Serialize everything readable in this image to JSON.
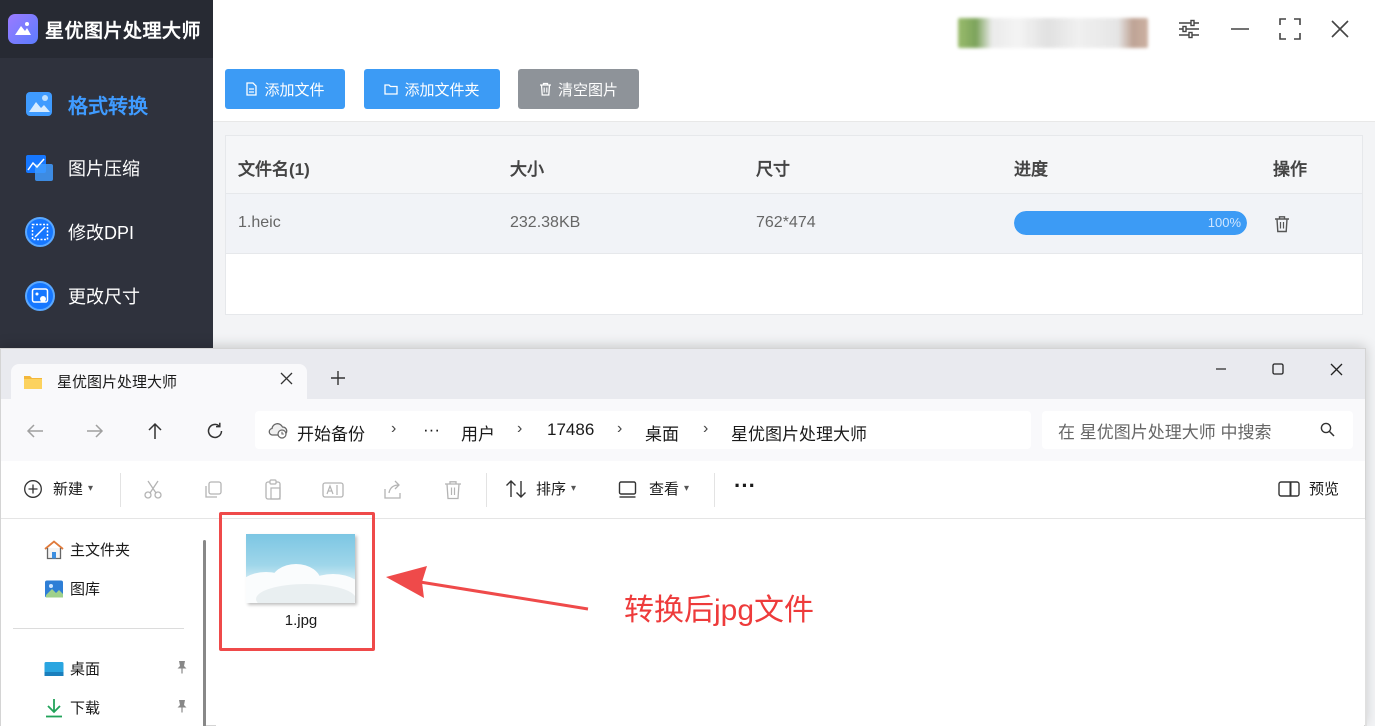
{
  "app": {
    "title": "星优图片处理大师",
    "nav": [
      {
        "label": "格式转换",
        "icon": "image-convert-icon",
        "active": true
      },
      {
        "label": "图片压缩",
        "icon": "image-compress-icon"
      },
      {
        "label": "修改DPI",
        "icon": "dpi-icon"
      },
      {
        "label": "更改尺寸",
        "icon": "resize-icon"
      }
    ],
    "toolbar": {
      "add_file": "添加文件",
      "add_folder": "添加文件夹",
      "clear": "清空图片"
    },
    "table": {
      "headers": [
        "文件名(1)",
        "大小",
        "尺寸",
        "进度",
        "操作"
      ],
      "rows": [
        {
          "name": "1.heic",
          "size": "232.38KB",
          "dimensions": "762*474",
          "progress_text": "100%",
          "progress": 1.0
        }
      ]
    },
    "colors": {
      "accent": "#3c9bf5",
      "sidebar": "#2f323d",
      "active_nav": "#3f9bff"
    }
  },
  "explorer": {
    "tab_title": "星优图片处理大师",
    "breadcrumbs": [
      "开始备份",
      "···",
      "用户",
      "17486",
      "桌面",
      "星优图片处理大师"
    ],
    "search_placeholder": "在 星优图片处理大师 中搜索",
    "commands": {
      "new": "新建",
      "sort": "排序",
      "view": "查看",
      "more": "···",
      "preview": "预览"
    },
    "nav_pane": [
      "主文件夹",
      "图库",
      "桌面",
      "下载"
    ],
    "files": [
      {
        "name": "1.jpg"
      }
    ]
  },
  "annotation": {
    "text": "转换后jpg文件",
    "color": "#ee3b3b"
  }
}
